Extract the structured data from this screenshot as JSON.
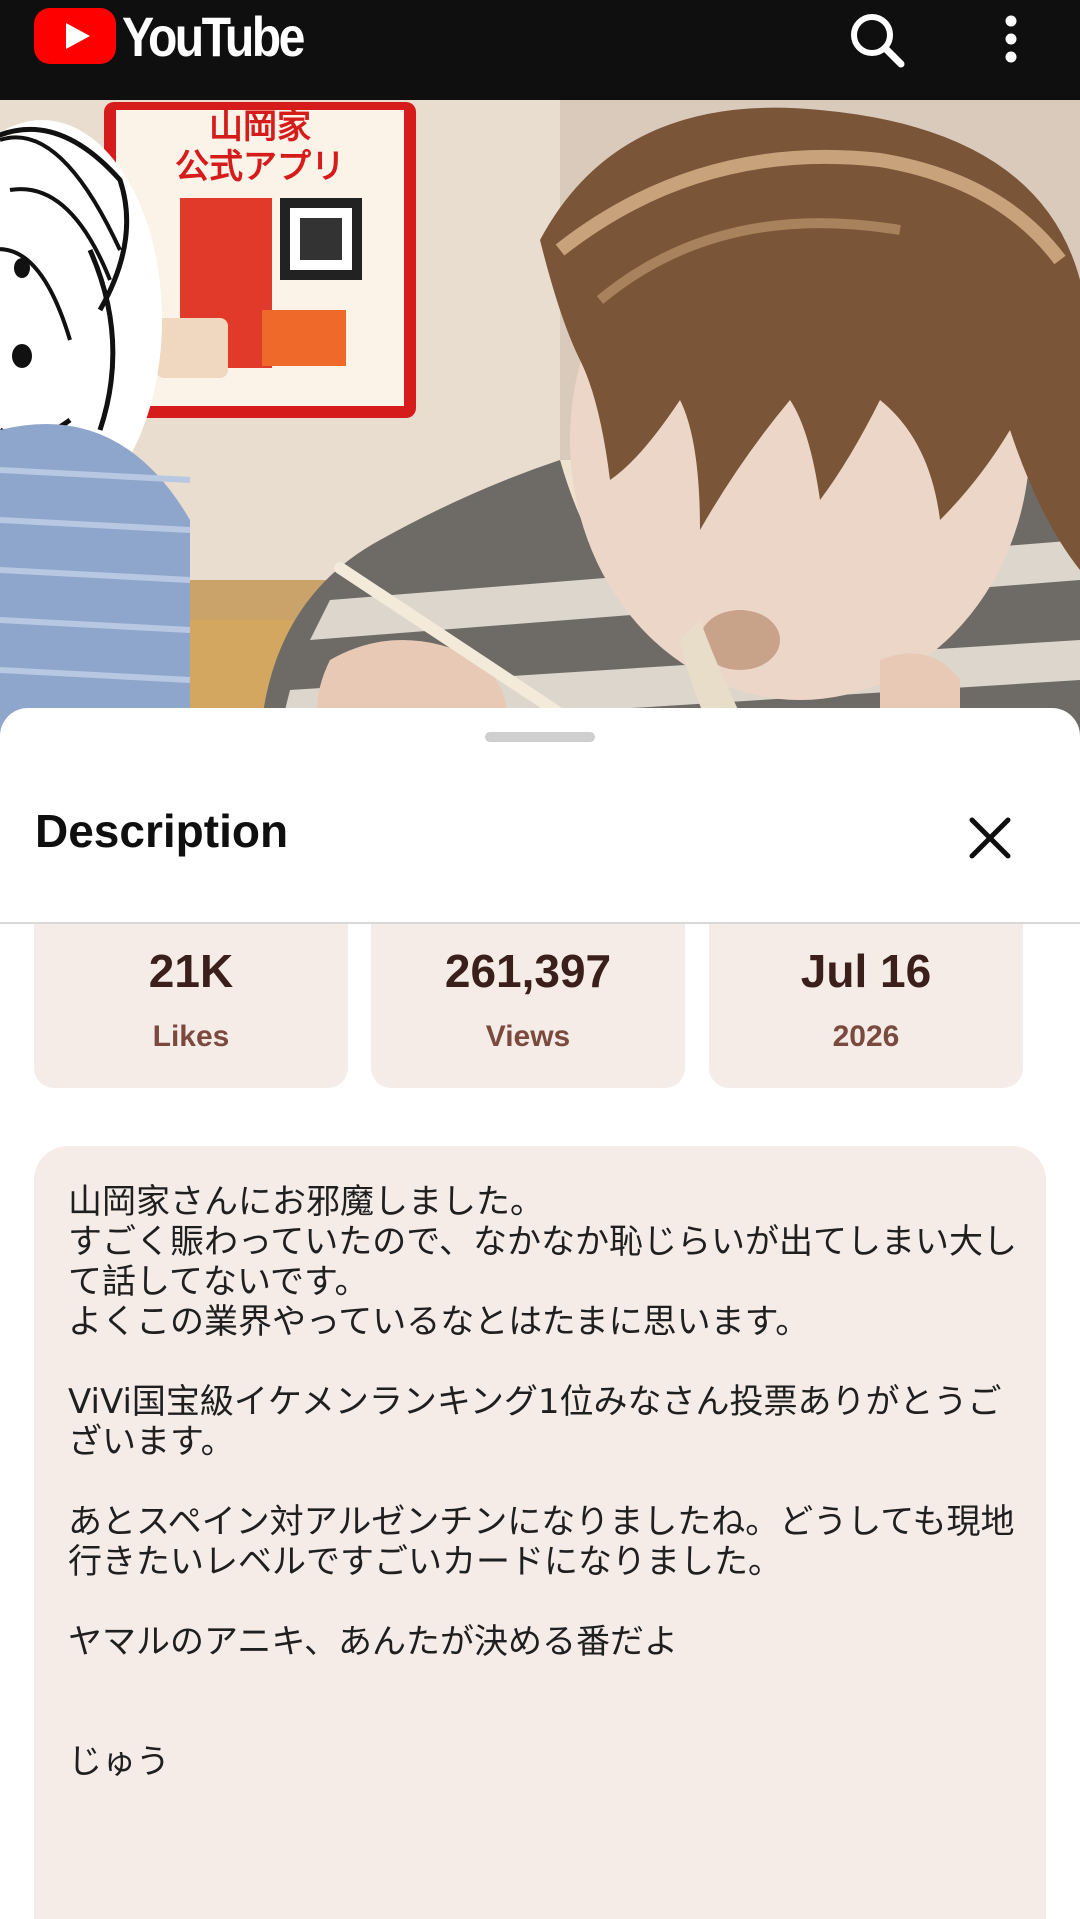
{
  "app": {
    "logo_text": "YouTube",
    "icons": {
      "search": "search-icon",
      "more": "more-vert-icon",
      "close": "close-icon"
    },
    "colors": {
      "brand_red": "#ff0000",
      "topbar_bg": "#0f0f0f",
      "card_bg": "#f5ece8",
      "stat_label": "#7b4a3e"
    }
  },
  "video": {
    "poster_title": "山岡家",
    "poster_subtitle": "公式アプリ"
  },
  "sheet": {
    "title": "Description",
    "stats": [
      {
        "value": "21K",
        "label": "Likes"
      },
      {
        "value": "261,397",
        "label": "Views"
      },
      {
        "value": "Jul 16",
        "label": "2026"
      }
    ],
    "description": "山岡家さんにお邪魔しました。\nすごく賑わっていたので、なかなか恥じらいが出てしまい大して話してないです。\nよくこの業界やっているなとはたまに思います。\n\nViVi国宝級イケメンランキング1位みなさん投票ありがとうございます。\n\nあとスペイン対アルゼンチンになりましたね。どうしても現地行きたいレベルですごいカードになりました。\n\nヤマルのアニキ、あんたが決める番だよ\n\n\nじゅう"
  }
}
